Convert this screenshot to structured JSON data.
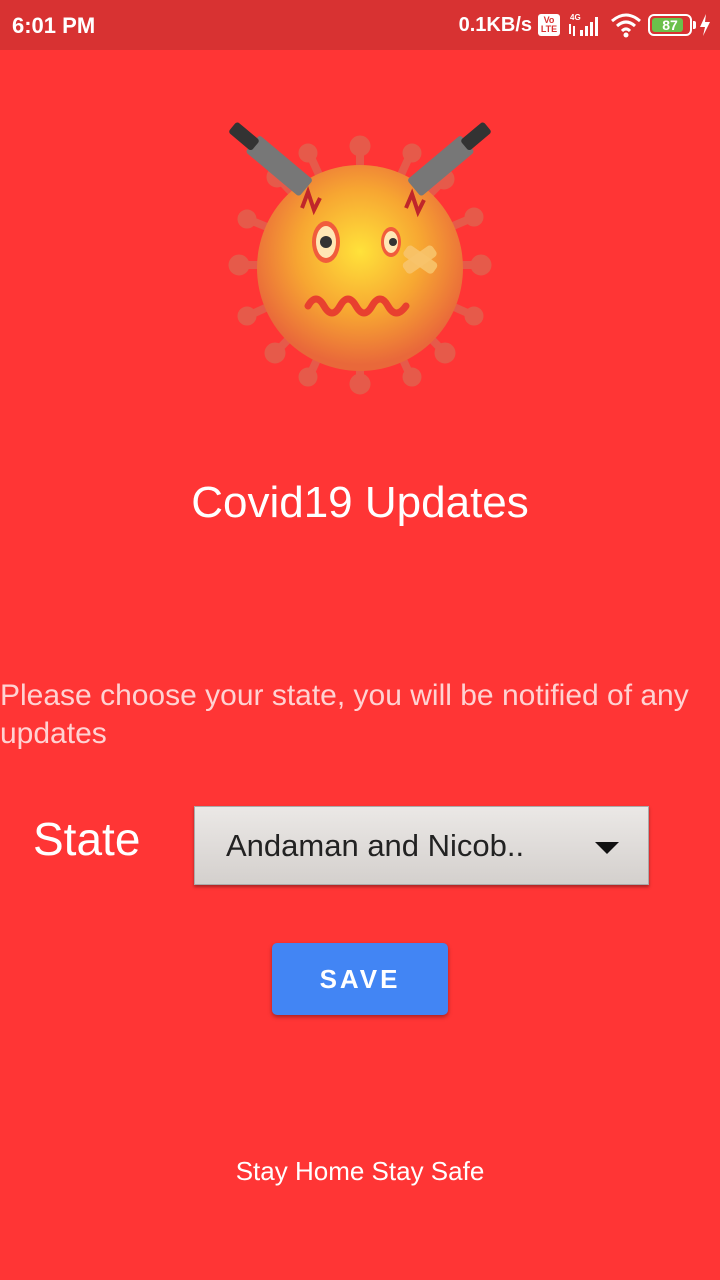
{
  "status_bar": {
    "time": "6:01 PM",
    "net_speed": "0.1KB/s",
    "volte_top": "Vo",
    "volte_bottom": "LTE",
    "network": "4G",
    "battery_level": "87",
    "battery_fraction": 0.87
  },
  "icons": {
    "signal": "signal-bars-icon",
    "wifi": "wifi-icon",
    "battery": "battery-icon",
    "charging": "lightning-icon",
    "virus": "virus-illustration-icon"
  },
  "app": {
    "title": "Covid19 Updates",
    "prompt": "Please choose your state, you will be notified of any updates"
  },
  "form": {
    "state_label": "State",
    "state_value": "Andaman and Nicob..",
    "save_label": "SAVE"
  },
  "footer": {
    "text": "Stay Home Stay Safe"
  },
  "colors": {
    "background": "#ff3535",
    "status_bar": "#d83232",
    "button": "#4285f4"
  }
}
